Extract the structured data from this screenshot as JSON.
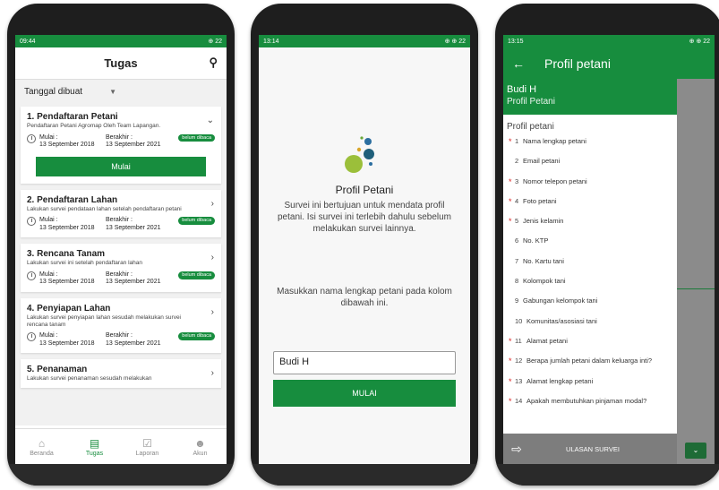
{
  "phone1": {
    "status": {
      "time": "09:44",
      "right": "⊕ 22"
    },
    "title": "Tugas",
    "sort_label": "Tanggal dibuat",
    "tasks": [
      {
        "title": "1. Pendaftaran Petani",
        "desc": "Pendaftaran Petani Agromap Oleh Team Lapangan.",
        "start_label": "Mulai :",
        "start": "13 September 2018",
        "end_label": "Berakhir :",
        "end": "13 September 2021",
        "badge": "belum dibaca",
        "button": "Mulai"
      },
      {
        "title": "2. Pendaftaran Lahan",
        "desc": "Lakukan survei pendataan lahan setelah pendaftaran petani",
        "start_label": "Mulai :",
        "start": "13 September 2018",
        "end_label": "Berakhir :",
        "end": "13 September 2021",
        "badge": "belum dibaca"
      },
      {
        "title": "3. Rencana Tanam",
        "desc": "Lakukan survei ini setelah pendaftaran lahan",
        "start_label": "Mulai :",
        "start": "13 September 2018",
        "end_label": "Berakhir :",
        "end": "13 September 2021",
        "badge": "belum dibaca"
      },
      {
        "title": "4. Penyiapan Lahan",
        "desc": "Lakukan survei penyiapan lahan sesudah melakukan survei rencana tanam",
        "start_label": "Mulai :",
        "start": "13 September 2018",
        "end_label": "Berakhir :",
        "end": "13 September 2021",
        "badge": "belum dibaca"
      },
      {
        "title": "5. Penanaman",
        "desc": "Lakukan survei penanaman sesudah melakukan"
      }
    ],
    "nav": [
      "Beranda",
      "Tugas",
      "Laporan",
      "Akun"
    ]
  },
  "phone2": {
    "status": {
      "time": "13:14",
      "right": "⊕ ⊕ 22"
    },
    "title": "Profil Petani",
    "desc": "Survei ini bertujuan untuk mendata profil petani. Isi survei ini terlebih dahulu sebelum melakukan survei lainnya.",
    "prompt": "Masukkan nama lengkap petani pada kolom dibawah ini.",
    "input_value": "Budi H",
    "button": "MULAI"
  },
  "phone3": {
    "status": {
      "time": "13:15",
      "right": "⊕ ⊕ 22"
    },
    "title": "Profil petani",
    "drawer_name": "Budi H",
    "drawer_sub": "Profil Petani",
    "section": "Profil petani",
    "items": [
      {
        "num": "1",
        "label": "Nama lengkap petani",
        "req": true
      },
      {
        "num": "2",
        "label": "Email petani",
        "req": false
      },
      {
        "num": "3",
        "label": "Nomor telepon petani",
        "req": true
      },
      {
        "num": "4",
        "label": "Foto petani",
        "req": true
      },
      {
        "num": "5",
        "label": "Jenis kelamin",
        "req": true
      },
      {
        "num": "6",
        "label": "No. KTP",
        "req": false
      },
      {
        "num": "7",
        "label": "No. Kartu tani",
        "req": false
      },
      {
        "num": "8",
        "label": "Kolompok tani",
        "req": false
      },
      {
        "num": "9",
        "label": "Gabungan kelompok tani",
        "req": false
      },
      {
        "num": "10",
        "label": "Komunitas/asosiasi tani",
        "req": false
      },
      {
        "num": "11",
        "label": "Alamat petani",
        "req": true
      },
      {
        "num": "12",
        "label": "Berapa jumlah petani dalam keluarga inti?",
        "req": true
      },
      {
        "num": "13",
        "label": "Alamat lengkap petani",
        "req": true
      },
      {
        "num": "14",
        "label": "Apakah membutuhkan pinjaman modal?",
        "req": true
      }
    ],
    "footer": "ULASAN SURVEI"
  },
  "colors": {
    "primary": "#178d3e",
    "required": "#d22222"
  }
}
